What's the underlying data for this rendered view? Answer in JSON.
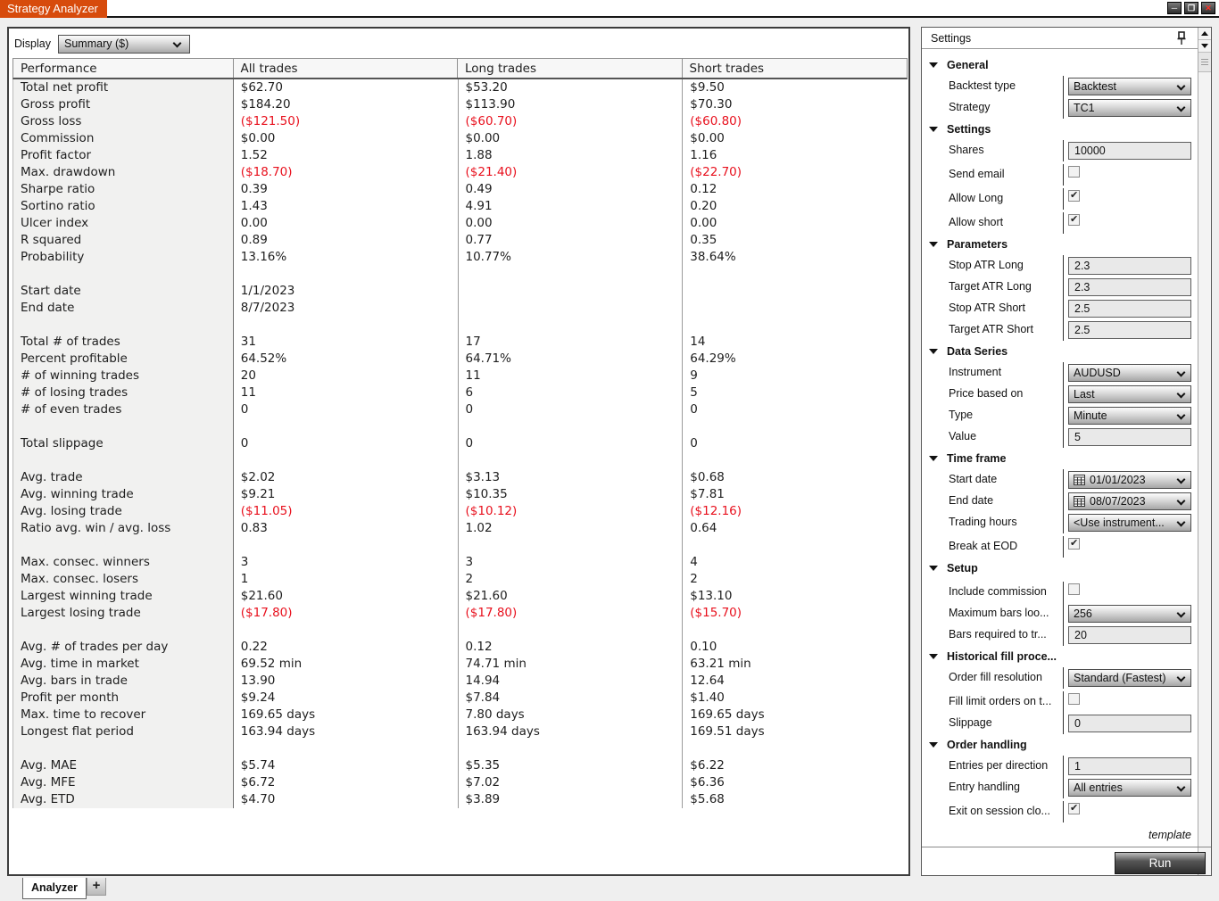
{
  "window": {
    "title": "Strategy Analyzer",
    "minimize": "─",
    "maximize": "❐",
    "close": "✕"
  },
  "toolbar": {
    "display_label": "Display",
    "display_value": "Summary ($)"
  },
  "table": {
    "headers": [
      "Performance",
      "All trades",
      "Long trades",
      "Short trades"
    ],
    "rows": [
      {
        "label": "Total net profit",
        "all": "$62.70",
        "long": "$53.20",
        "short": "$9.50"
      },
      {
        "label": "Gross profit",
        "all": "$184.20",
        "long": "$113.90",
        "short": "$70.30"
      },
      {
        "label": "Gross loss",
        "all": "($121.50)",
        "long": "($60.70)",
        "short": "($60.80)"
      },
      {
        "label": "Commission",
        "all": "$0.00",
        "long": "$0.00",
        "short": "$0.00"
      },
      {
        "label": "Profit factor",
        "all": "1.52",
        "long": "1.88",
        "short": "1.16"
      },
      {
        "label": "Max. drawdown",
        "all": "($18.70)",
        "long": "($21.40)",
        "short": "($22.70)"
      },
      {
        "label": "Sharpe ratio",
        "all": "0.39",
        "long": "0.49",
        "short": "0.12"
      },
      {
        "label": "Sortino ratio",
        "all": "1.43",
        "long": "4.91",
        "short": "0.20"
      },
      {
        "label": "Ulcer index",
        "all": "0.00",
        "long": "0.00",
        "short": "0.00"
      },
      {
        "label": "R squared",
        "all": "0.89",
        "long": "0.77",
        "short": "0.35"
      },
      {
        "label": "Probability",
        "all": "13.16%",
        "long": "10.77%",
        "short": "38.64%"
      },
      {
        "blank": true
      },
      {
        "label": "Start date",
        "all": "1/1/2023",
        "long": "",
        "short": ""
      },
      {
        "label": "End date",
        "all": "8/7/2023",
        "long": "",
        "short": ""
      },
      {
        "blank": true
      },
      {
        "label": "Total # of trades",
        "all": "31",
        "long": "17",
        "short": "14"
      },
      {
        "label": "Percent profitable",
        "all": "64.52%",
        "long": "64.71%",
        "short": "64.29%"
      },
      {
        "label": "# of winning trades",
        "all": "20",
        "long": "11",
        "short": "9"
      },
      {
        "label": "# of losing trades",
        "all": "11",
        "long": "6",
        "short": "5"
      },
      {
        "label": "# of even trades",
        "all": "0",
        "long": "0",
        "short": "0"
      },
      {
        "blank": true
      },
      {
        "label": "Total slippage",
        "all": "0",
        "long": "0",
        "short": "0"
      },
      {
        "blank": true
      },
      {
        "label": "Avg. trade",
        "all": "$2.02",
        "long": "$3.13",
        "short": "$0.68"
      },
      {
        "label": "Avg. winning trade",
        "all": "$9.21",
        "long": "$10.35",
        "short": "$7.81"
      },
      {
        "label": "Avg. losing trade",
        "all": "($11.05)",
        "long": "($10.12)",
        "short": "($12.16)"
      },
      {
        "label": "Ratio avg. win / avg. loss",
        "all": "0.83",
        "long": "1.02",
        "short": "0.64"
      },
      {
        "blank": true
      },
      {
        "label": "Max. consec. winners",
        "all": "3",
        "long": "3",
        "short": "4"
      },
      {
        "label": "Max. consec. losers",
        "all": "1",
        "long": "2",
        "short": "2"
      },
      {
        "label": "Largest winning trade",
        "all": "$21.60",
        "long": "$21.60",
        "short": "$13.10"
      },
      {
        "label": "Largest losing trade",
        "all": "($17.80)",
        "long": "($17.80)",
        "short": "($15.70)"
      },
      {
        "blank": true
      },
      {
        "label": "Avg. # of trades per day",
        "all": "0.22",
        "long": "0.12",
        "short": "0.10"
      },
      {
        "label": "Avg. time in market",
        "all": "69.52 min",
        "long": "74.71 min",
        "short": "63.21 min"
      },
      {
        "label": "Avg. bars in trade",
        "all": "13.90",
        "long": "14.94",
        "short": "12.64"
      },
      {
        "label": "Profit per month",
        "all": "$9.24",
        "long": "$7.84",
        "short": "$1.40"
      },
      {
        "label": "Max. time to recover",
        "all": "169.65 days",
        "long": "7.80 days",
        "short": "169.65 days"
      },
      {
        "label": "Longest flat period",
        "all": "163.94 days",
        "long": "163.94 days",
        "short": "169.51 days"
      },
      {
        "blank": true
      },
      {
        "label": "Avg. MAE",
        "all": "$5.74",
        "long": "$5.35",
        "short": "$6.22"
      },
      {
        "label": "Avg. MFE",
        "all": "$6.72",
        "long": "$7.02",
        "short": "$6.36"
      },
      {
        "label": "Avg. ETD",
        "all": "$4.70",
        "long": "$3.89",
        "short": "$5.68"
      }
    ]
  },
  "settings": {
    "title": "Settings",
    "sections": [
      {
        "label": "General",
        "items": [
          {
            "label": "Backtest type",
            "type": "select",
            "value": "Backtest"
          },
          {
            "label": "Strategy",
            "type": "select",
            "value": "TC1"
          }
        ]
      },
      {
        "label": "Settings",
        "items": [
          {
            "label": "Shares",
            "type": "text",
            "value": "10000"
          },
          {
            "label": "Send email",
            "type": "check",
            "checked": false
          },
          {
            "label": "Allow Long",
            "type": "check",
            "checked": true
          },
          {
            "label": "Allow short",
            "type": "check",
            "checked": true
          }
        ]
      },
      {
        "label": "Parameters",
        "items": [
          {
            "label": "Stop ATR Long",
            "type": "text",
            "value": "2.3"
          },
          {
            "label": "Target ATR Long",
            "type": "text",
            "value": "2.3"
          },
          {
            "label": "Stop ATR Short",
            "type": "text",
            "value": "2.5"
          },
          {
            "label": "Target ATR Short",
            "type": "text",
            "value": "2.5"
          }
        ]
      },
      {
        "label": "Data Series",
        "items": [
          {
            "label": "Instrument",
            "type": "select",
            "value": "AUDUSD"
          },
          {
            "label": "Price based on",
            "type": "select",
            "value": "Last"
          },
          {
            "label": "Type",
            "type": "select",
            "value": "Minute"
          },
          {
            "label": "Value",
            "type": "text",
            "value": "5"
          }
        ]
      },
      {
        "label": "Time frame",
        "items": [
          {
            "label": "Start date",
            "type": "dateselect",
            "value": "01/01/2023"
          },
          {
            "label": "End date",
            "type": "dateselect",
            "value": "08/07/2023"
          },
          {
            "label": "Trading hours",
            "type": "select",
            "value": "<Use instrument..."
          },
          {
            "label": "Break at EOD",
            "type": "check",
            "checked": true
          }
        ]
      },
      {
        "label": "Setup",
        "items": [
          {
            "label": "Include commission",
            "type": "check",
            "checked": false
          },
          {
            "label": "Maximum bars loo...",
            "type": "select",
            "value": "256"
          },
          {
            "label": "Bars required to tr...",
            "type": "text",
            "value": "20"
          }
        ]
      },
      {
        "label": "Historical fill proce...",
        "items": [
          {
            "label": "Order fill resolution",
            "type": "select",
            "value": "Standard (Fastest)"
          },
          {
            "label": "Fill limit orders on t...",
            "type": "check",
            "checked": false
          },
          {
            "label": "Slippage",
            "type": "text",
            "value": "0"
          }
        ]
      },
      {
        "label": "Order handling",
        "items": [
          {
            "label": "Entries per direction",
            "type": "text",
            "value": "1"
          },
          {
            "label": "Entry handling",
            "type": "select",
            "value": "All entries"
          },
          {
            "label": "Exit on session clo...",
            "type": "check",
            "checked": true
          }
        ]
      }
    ],
    "template_label": "template",
    "run_label": "Run"
  },
  "tabs": {
    "analyzer": "Analyzer",
    "add": "+"
  },
  "colors": {
    "accent": "#d74b0c",
    "negative": "#e8101d"
  }
}
